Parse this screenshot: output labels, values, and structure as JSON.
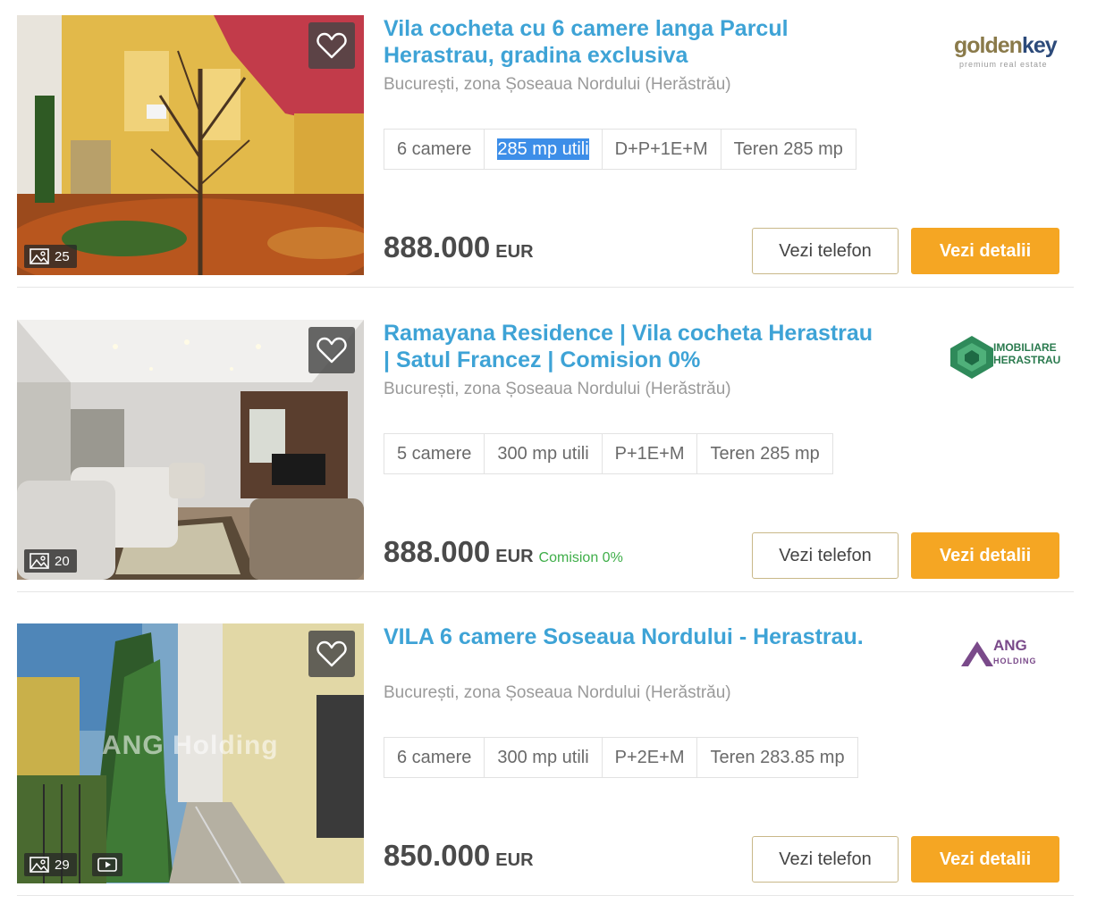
{
  "listings": [
    {
      "title": "Vila cocheta cu 6 camere langa Parcul Herastrau, gradina exclusiva",
      "location": "București, zona Șoseaua Nordului (Herăstrău)",
      "features": [
        "6 camere",
        "285 mp utili",
        "D+P+1E+M",
        "Teren 285 mp"
      ],
      "selected_feature_text": "285 mp utili",
      "price": "888.000",
      "currency": "EUR",
      "commission": "",
      "photo_count": "25",
      "has_video": false,
      "agency_logo": {
        "name": "golden",
        "accent": "key",
        "tagline": "premium real estate"
      },
      "phone_label": "Vezi telefon",
      "details_label": "Vezi detalii"
    },
    {
      "title": "Ramayana Residence | Vila cocheta Herastrau | Satul Francez | Comision 0%",
      "location": "București, zona Șoseaua Nordului (Herăstrău)",
      "features": [
        "5 camere",
        "300 mp utili",
        "P+1E+M",
        "Teren 285 mp"
      ],
      "selected_feature_text": "",
      "price": "888.000",
      "currency": "EUR",
      "commission": "Comision 0%",
      "photo_count": "20",
      "has_video": false,
      "agency_logo": {
        "line1": "IMOBILIARE",
        "line2": "HERASTRAU"
      },
      "phone_label": "Vezi telefon",
      "details_label": "Vezi detalii"
    },
    {
      "title": "VILA 6 camere Soseaua Nordului - Herastrau.",
      "location": "București, zona Șoseaua Nordului (Herăstrău)",
      "features": [
        "6 camere",
        "300 mp utili",
        "P+2E+M",
        "Teren 283.85 mp"
      ],
      "selected_feature_text": "",
      "price": "850.000",
      "currency": "EUR",
      "commission": "",
      "photo_count": "29",
      "has_video": true,
      "photo_watermark": "ANG Holding",
      "agency_logo": {
        "line1": "ANG",
        "line2": "HOLDING"
      },
      "phone_label": "Vezi telefon",
      "details_label": "Vezi detalii"
    }
  ],
  "colors": {
    "title": "#3ea3d6",
    "primary_button": "#f5a623",
    "commission": "#3fae49",
    "selection": "#3d8ee8"
  },
  "icons": [
    "heart-icon",
    "image-gallery-icon",
    "video-icon"
  ]
}
